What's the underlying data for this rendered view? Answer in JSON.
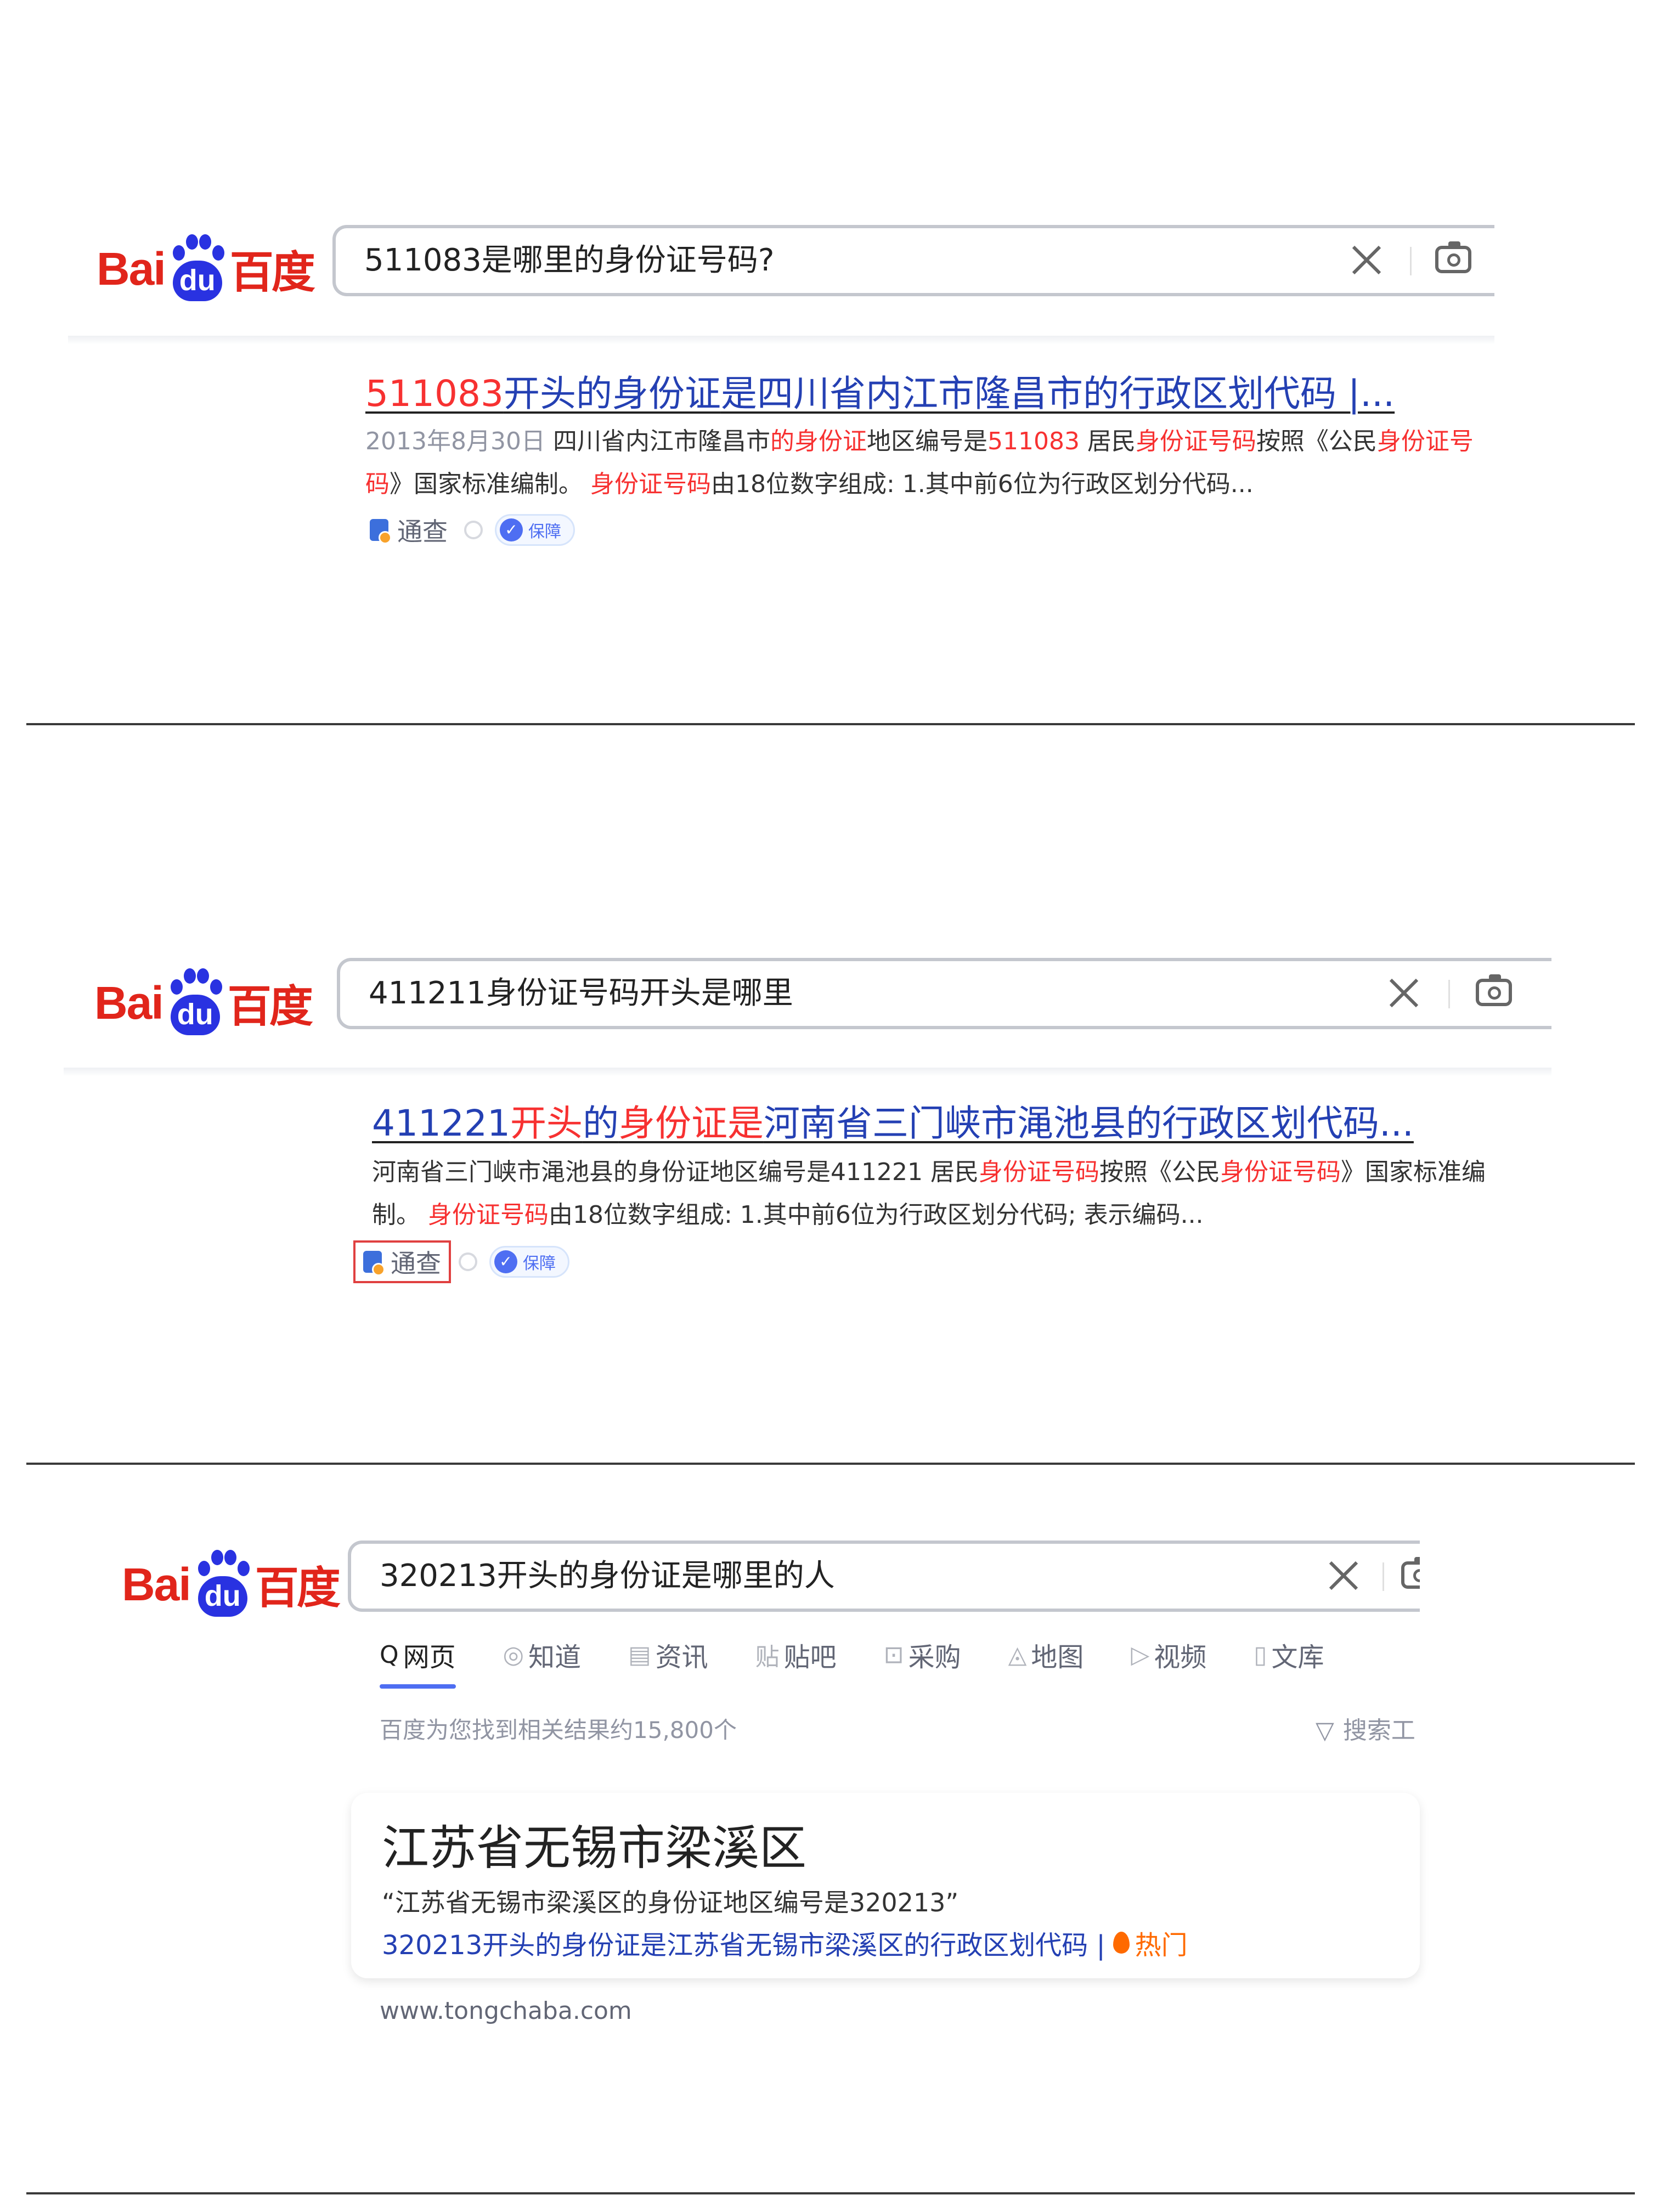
{
  "logo": {
    "bai": "Bai",
    "du": "du",
    "cn": "百度"
  },
  "panel1": {
    "query": "511083是哪里的身份证号码?",
    "title_parts": [
      {
        "t": "511083",
        "hl": true
      },
      {
        "t": "开头的身份证",
        "hl": false
      },
      {
        "t": "是四川省内江市隆昌市的行政区划代码 |...",
        "hl": false
      }
    ],
    "snippet_date": "2013年8月30日",
    "snippet_parts": [
      {
        "t": " 四川省内江市隆昌市",
        "hl": false
      },
      {
        "t": "的身份证",
        "hl": true
      },
      {
        "t": "地区编号是",
        "hl": false
      },
      {
        "t": "511083",
        "hl": true
      },
      {
        "t": " 居民",
        "hl": false
      },
      {
        "t": "身份证号码",
        "hl": true
      },
      {
        "t": "按照《公民",
        "hl": false
      },
      {
        "t": "身份证号码",
        "hl": true
      },
      {
        "t": "》国家标准编制。 ",
        "hl": false
      },
      {
        "t": "身份证号码",
        "hl": true
      },
      {
        "t": "由18位数字组成: 1.其中前6位为行政区划分代码...",
        "hl": false
      }
    ],
    "source": "通查",
    "badge": "保障"
  },
  "panel2": {
    "query": "411211身份证号码开头是哪里",
    "title_parts": [
      {
        "t": "411221",
        "hl": false
      },
      {
        "t": "开头",
        "hl": true
      },
      {
        "t": "的",
        "hl": false
      },
      {
        "t": "身份证是",
        "hl": true
      },
      {
        "t": "河南省三门峡市渑池县的行政区划代码...",
        "hl": false
      }
    ],
    "snippet_parts": [
      {
        "t": "河南省三门峡市渑池县的身份证地区编号是411221 居民",
        "hl": false
      },
      {
        "t": "身份证号码",
        "hl": true
      },
      {
        "t": "按照《公民",
        "hl": false
      },
      {
        "t": "身份证号码",
        "hl": true
      },
      {
        "t": "》国家标准编制。 ",
        "hl": false
      },
      {
        "t": "身份证号码",
        "hl": true
      },
      {
        "t": "由18位数字组成: 1.其中前6位为行政区划分代码; 表示编码...",
        "hl": false
      }
    ],
    "source": "通查",
    "badge": "保障"
  },
  "panel3": {
    "query": "320213开头的身份证是哪里的人",
    "tabs": [
      {
        "icon": "Q",
        "label": "网页"
      },
      {
        "icon": "◎",
        "label": "知道"
      },
      {
        "icon": "▤",
        "label": "资讯"
      },
      {
        "icon": "贴",
        "label": "贴吧"
      },
      {
        "icon": "⊡",
        "label": "采购"
      },
      {
        "icon": "◬",
        "label": "地图"
      },
      {
        "icon": "▷",
        "label": "视频"
      },
      {
        "icon": "▯",
        "label": "文库"
      }
    ],
    "result_count": "百度为您找到相关结果约15,800个",
    "search_tools": "搜索工",
    "card_title": "江苏省无锡市梁溪区",
    "card_quote": "“江苏省无锡市梁溪区的身份证地区编号是320213”",
    "card_link": "320213开头的身份证是江苏省无锡市梁溪区的行政区划代码 |",
    "card_hot": "热门",
    "url": "www.tongchaba.com"
  },
  "colors": {
    "brand_red": "#e1251b",
    "brand_blue": "#2932e1",
    "link_blue": "#2440b3",
    "highlight_red": "#f73131",
    "tab_accent": "#4e6ef2"
  }
}
